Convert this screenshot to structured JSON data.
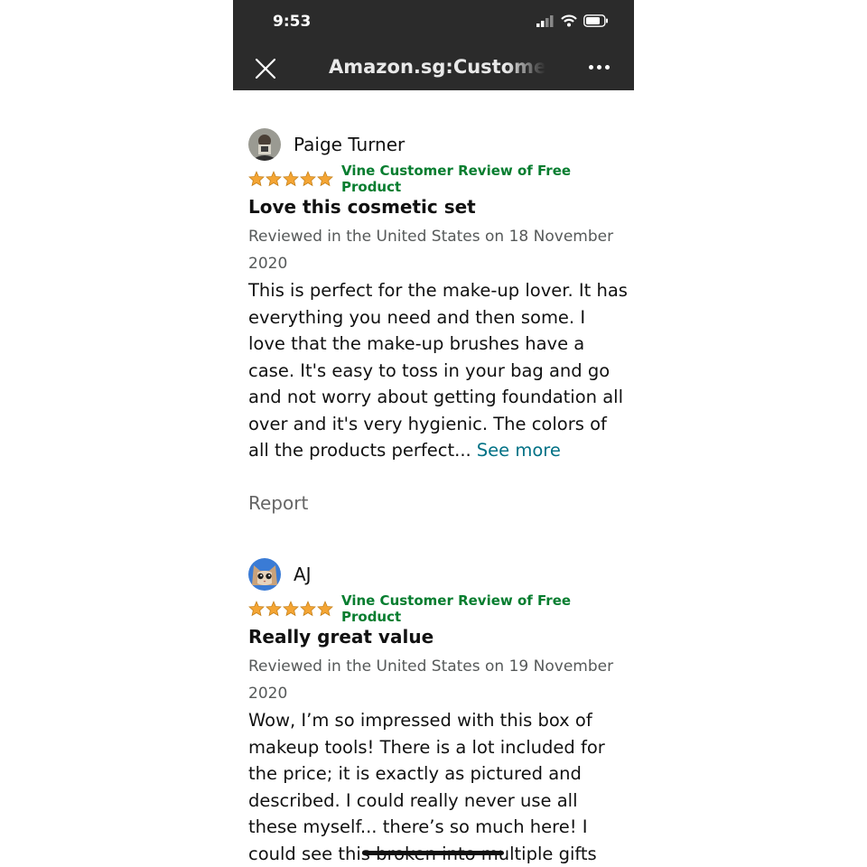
{
  "status_bar": {
    "time": "9:53"
  },
  "nav": {
    "title": "Amazon.sg:Customer Reviews"
  },
  "reviews": [
    {
      "reviewer": "Paige Turner",
      "rating": 5,
      "badge": "Vine Customer Review of Free Product",
      "title": "Love this cosmetic set",
      "date": "Reviewed in the United States on 18 November 2020",
      "body": "This is perfect for the make-up lover. It has everything you need and then some. I love that the make-up brushes have a case. It's easy to toss in your bag and go and not worry about getting foundation all over and it's very hygienic. The colors of all the products perfect...",
      "see_more": "See more",
      "report": "Report"
    },
    {
      "reviewer": "AJ",
      "rating": 5,
      "badge": "Vine Customer Review of Free Product",
      "title": "Really great value",
      "date": "Reviewed in the United States on 19 November 2020",
      "body": "Wow, I’m so impressed with this box of makeup tools! There is a lot included for the price; it is exactly as pictured and described. I could really never use all these myself... there’s so much here! I could see this broken into multiple gifts"
    }
  ],
  "colors": {
    "star": "#f4a534",
    "vine_badge": "#067d2f",
    "link": "#007185",
    "header_bg": "#2b2b2b"
  }
}
